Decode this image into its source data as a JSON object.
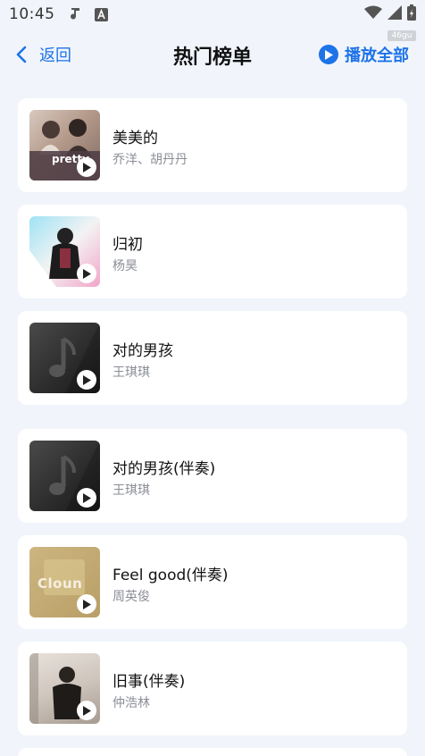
{
  "status_bar": {
    "time": "10:45",
    "watermark": "46gu",
    "icons": [
      "music-note-icon",
      "a-box-icon",
      "wifi-icon",
      "signal-icon",
      "battery-icon"
    ]
  },
  "nav": {
    "back_label": "返回",
    "title": "热门榜单",
    "play_all_label": "播放全部"
  },
  "accent_color": "#1d73e8",
  "songs": [
    {
      "title": "美美的",
      "artist": "乔洋、胡丹丹",
      "cover_text": "pretty"
    },
    {
      "title": "归初",
      "artist": "杨昊",
      "cover_text": ""
    },
    {
      "title": "对的男孩",
      "artist": "王琪琪",
      "cover_text": ""
    },
    {
      "title": "对的男孩(伴奏)",
      "artist": "王琪琪",
      "cover_text": ""
    },
    {
      "title": "Feel good(伴奏)",
      "artist": "周英俊",
      "cover_text": "Cloun"
    },
    {
      "title": "旧事(伴奏)",
      "artist": "仲浩林",
      "cover_text": ""
    }
  ]
}
